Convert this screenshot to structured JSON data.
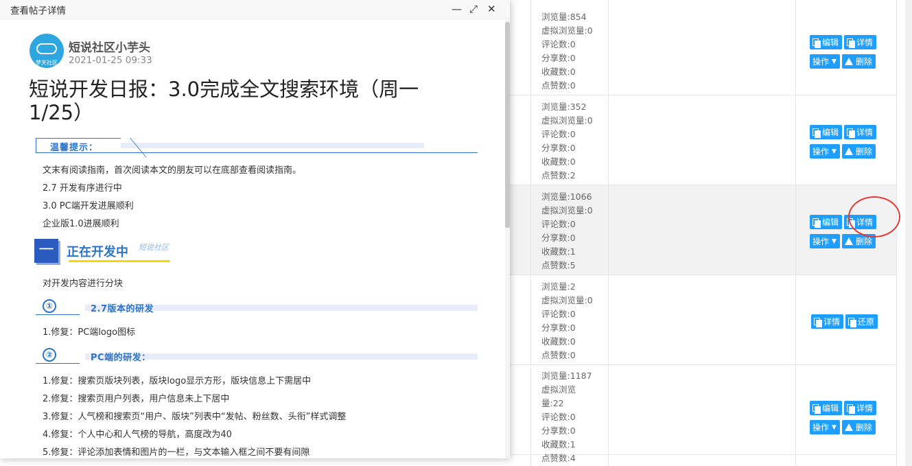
{
  "dialog": {
    "title": "查看帖子详情",
    "controls": {
      "minimize": "—",
      "maximize": "⤢",
      "close": "✕"
    },
    "author": {
      "name": "短说社区小芋头",
      "avatar_label": "梦天社区",
      "date": "2021-01-25 09:33"
    },
    "post_title": "短说开发日报：3.0完成全文搜索环境（周一1/25）",
    "tip_label": "温馨提示：",
    "intro": [
      "文末有阅读指南，首次阅读本文的朋友可以在底部查看阅读指南。",
      "2.7 开发有序进行中",
      "3.0 PC端开发进展顺利",
      "企业版1.0进展顺利"
    ],
    "section1": {
      "number": "一",
      "title": "正在开发中",
      "tag": "短说社区"
    },
    "section1_desc": "对开发内容进行分块",
    "sub1": {
      "number": "①",
      "title": "2.7版本的研发",
      "items": [
        "1.修复：PC端logo图标"
      ]
    },
    "sub2": {
      "number": "②",
      "title": "PC端的研发：",
      "items": [
        "1.修复：搜索页版块列表，版块logo显示方形，版块信息上下需居中",
        "2.修复：搜索页用户列表，用户信息未上下居中",
        "3.修复：人气榜和搜索页“用户、版块”列表中“发帖、粉丝数、头衔”样式调整",
        "4.修复：个人中心和人气榜的导航，高度改为40",
        "5.修复：评论添加表情和图片的一栏，与文本输入框之间不要有间隙"
      ]
    }
  },
  "table": {
    "rows": [
      {
        "stats": [
          "浏览量:854",
          "虚拟浏览量:0",
          "评论数:0",
          "分享数:0",
          "收藏数:0",
          "点赞数:0"
        ],
        "actions": "full"
      },
      {
        "stats": [
          "浏览量:352",
          "虚拟浏览量:0",
          "评论数:0",
          "分享数:0",
          "收藏数:0",
          "点赞数:2"
        ],
        "actions": "full"
      },
      {
        "stats": [
          "浏览量:1066",
          "虚拟浏览量:0",
          "评论数:0",
          "分享数:0",
          "收藏数:1",
          "点赞数:5"
        ],
        "actions": "full"
      },
      {
        "stats": [
          "浏览量:2",
          "虚拟浏览量:0",
          "评论数:0",
          "分享数:0",
          "收藏数:0",
          "点赞数:0"
        ],
        "actions": "restore"
      },
      {
        "stats": [
          "浏览量:1187",
          "虚拟浏览",
          "量:22",
          "评论数:0",
          "分享数:0",
          "收藏数:1",
          "点赞数:4"
        ],
        "actions": "full"
      }
    ],
    "labels": {
      "edit": "编辑",
      "detail": "详情",
      "ops": "操作",
      "delete": "删除",
      "restore": "还原"
    }
  },
  "colors": {
    "button": "#1e9fff",
    "highlight_circle": "#e53935",
    "heading": "#2a74c9"
  }
}
